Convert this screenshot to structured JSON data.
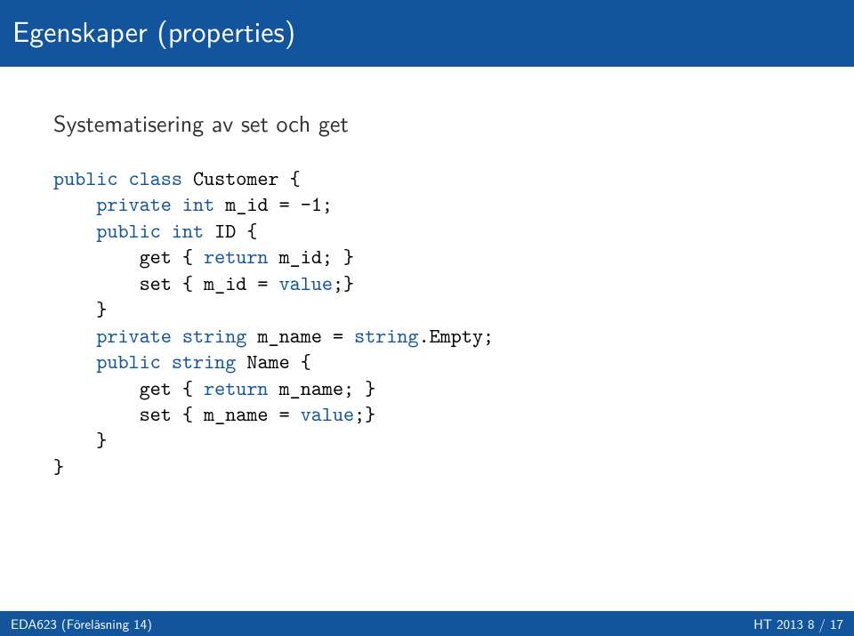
{
  "title": "Egenskaper (properties)",
  "subtitle": "Systematisering av set och get",
  "code": {
    "kw_public": "public",
    "kw_class": "class",
    "kw_private": "private",
    "kw_int": "int",
    "kw_return": "return",
    "kw_value": "value",
    "kw_string": "string",
    "kw_string2": "string",
    "t_customer": " Customer {",
    "t_mid_decl": " m_id = -1;",
    "t_idprop": " ID {",
    "t_get_open": "        get { ",
    "t_mid_ret": " m_id; }",
    "t_set_open": "        set { m_id = ",
    "t_valend": ";}",
    "t_mname_decl": " m_name = ",
    "t_empty": ".Empty;",
    "t_nameprop": " Name {",
    "t_mname_ret": " m_name; }",
    "t_set2_open": "        set { m_name = ",
    "t_brace_close": "    }",
    "t_brace_close2": "}"
  },
  "footer": {
    "left": "EDA623 (Föreläsning 14)",
    "right": "HT 2013     8 / 17"
  }
}
